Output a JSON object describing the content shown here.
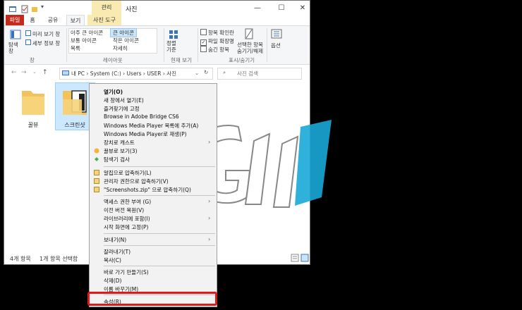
{
  "titlebar": {
    "context_tab": "관리",
    "title": "사진",
    "min": "—",
    "max": "☐",
    "close": "✕"
  },
  "tabs": {
    "file": "파일",
    "home": "홈",
    "share": "공유",
    "view": "보기",
    "photo_tools": "사진 도구"
  },
  "ribbon": {
    "nav_pane": "탐색\n창",
    "preview_pane": "미리 보기 창",
    "details_pane": "세부 정보 창",
    "panes_group": "창",
    "layout": {
      "extra_large": "아주 큰 아이콘",
      "large": "큰 아이콘",
      "medium": "보통 아이콘",
      "small": "작은 아이콘",
      "list": "목록",
      "details": "자세히",
      "group": "레이아웃"
    },
    "sort": "정렬\n기준",
    "current_view_group": "현재 보기",
    "item_checkboxes": "항목 확인란",
    "file_extensions": "파일 확장명",
    "hidden_items": "숨긴 항목",
    "hide_selected": "선택한 항목\n숨기기/해제",
    "show_hide_group": "표시/숨기기",
    "options": "옵션"
  },
  "address": {
    "path": "내 PC  ›  System (C:)  ›  Users  ›  USER  ›  사진",
    "search_placeholder": "사진 검색"
  },
  "files": [
    {
      "label": "꿀뷰"
    },
    {
      "label": "스크린샷"
    }
  ],
  "status": {
    "count": "4개 항목",
    "selected": "1개 항목 선택함"
  },
  "context_menu": {
    "items": [
      "열기(O)",
      "새 창에서 열기(E)",
      "즐겨찾기에 고정",
      "Browse in Adobe Bridge CS6",
      "Windows Media Player 목록에 추가(A)",
      "Windows Media Player로 재생(P)",
      "장치로 캐스트",
      "꿀뷰로 보기(3)",
      "탐색기 검사",
      "알집으로 압축하기(L)",
      "관리자 권한으로 압축하기(V)",
      "\"Screenshots.zip\" 으로 압축하기(Q)",
      "액세스 권한 부여 (G)",
      "이전 버전 복원(V)",
      "라이브러리에 포함(I)",
      "시작 화면에 고정(P)",
      "보내기(N)",
      "잘라내기(T)",
      "복사(C)",
      "바로 가기 만들기(S)",
      "삭제(D)",
      "이름 바꾸기(M)",
      "속성(R)"
    ]
  },
  "colors": {
    "file_tab": "#c42b1c",
    "highlight": "#e0191b",
    "context_tab": "#f8eab0"
  }
}
